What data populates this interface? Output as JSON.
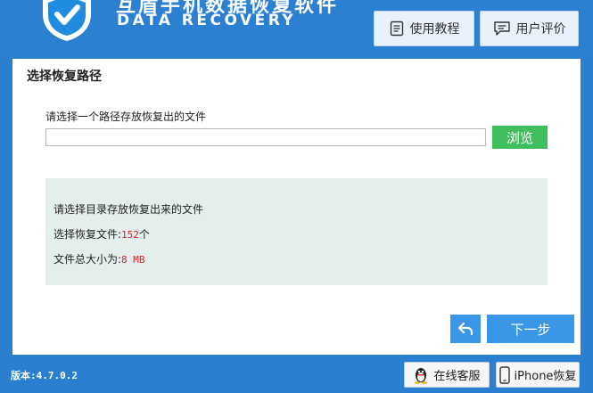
{
  "header": {
    "title": "互盾手机数据恢复软件",
    "subtitle": "DATA RECOVERY",
    "tutorial_label": "使用教程",
    "review_label": "用户评价"
  },
  "main": {
    "section_title": "选择恢复路径",
    "prompt_label": "请选择一个路径存放恢复出的文件",
    "path_value": "",
    "browse_label": "浏览",
    "info": {
      "line1": "请选择目录存放恢复出来的文件",
      "files_label": "选择恢复文件:",
      "files_count": "152",
      "files_unit": "个",
      "size_label": "文件总大小为:",
      "size_value": "8 MB"
    },
    "next_label": "下一步"
  },
  "footer": {
    "version": "版本:4.7.0.2",
    "service_label": "在线客服",
    "iphone_label": "iPhone恢复"
  },
  "icons": {
    "logo": "shield-check-icon",
    "tutorial": "document-list-icon",
    "review": "chat-bubble-icon",
    "back": "back-arrow-icon",
    "service": "qq-penguin-icon",
    "iphone": "phone-icon"
  },
  "colors": {
    "header_bg": "#2b80d2",
    "browse_bg": "#3fbe5e",
    "nav_button_bg": "#3a96e6",
    "info_bg": "#e4eeec",
    "highlight_value": "#e02020"
  }
}
